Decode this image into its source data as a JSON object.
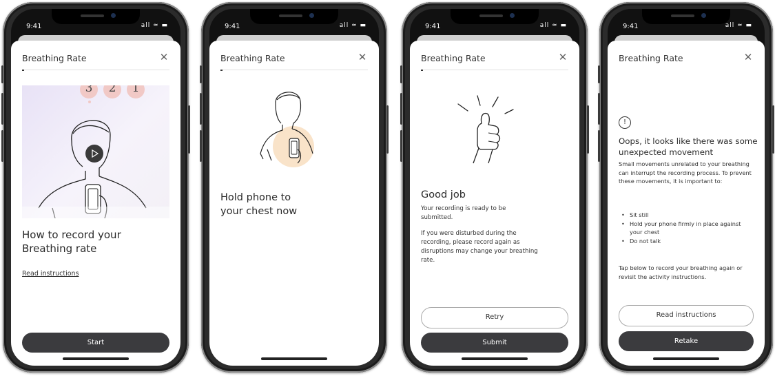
{
  "status": {
    "time": "9:41",
    "signal": "all ≈ ▬"
  },
  "screens": [
    {
      "title": "Breathing Rate",
      "countdown": [
        "3",
        "2",
        "1"
      ],
      "heading_line1": "How to record your",
      "heading_line2": "Breathing rate",
      "link": "Read instructions",
      "primary": "Start"
    },
    {
      "title": "Breathing Rate",
      "heading_line1": "Hold phone to",
      "heading_line2": "your chest now"
    },
    {
      "title": "Breathing Rate",
      "heading": "Good job",
      "body1": "Your recording is ready to be submitted.",
      "body2": "If you were disturbed during the recording, please record again as disruptions may change your breathing rate.",
      "secondary": "Retry",
      "primary": "Submit"
    },
    {
      "title": "Breathing Rate",
      "heading": "Oops, it looks like there was some unexpected movement",
      "body1": "Small movements unrelated to your breathing can interrupt the recording process. To prevent these movements, it is important to:",
      "bullets": [
        "Sit still",
        "Hold your phone firmly in place against your chest",
        "Do not talk"
      ],
      "body2": "Tap below to record your breathing again or revisit the activity instructions.",
      "secondary": "Read instructions",
      "primary": "Retake"
    }
  ]
}
